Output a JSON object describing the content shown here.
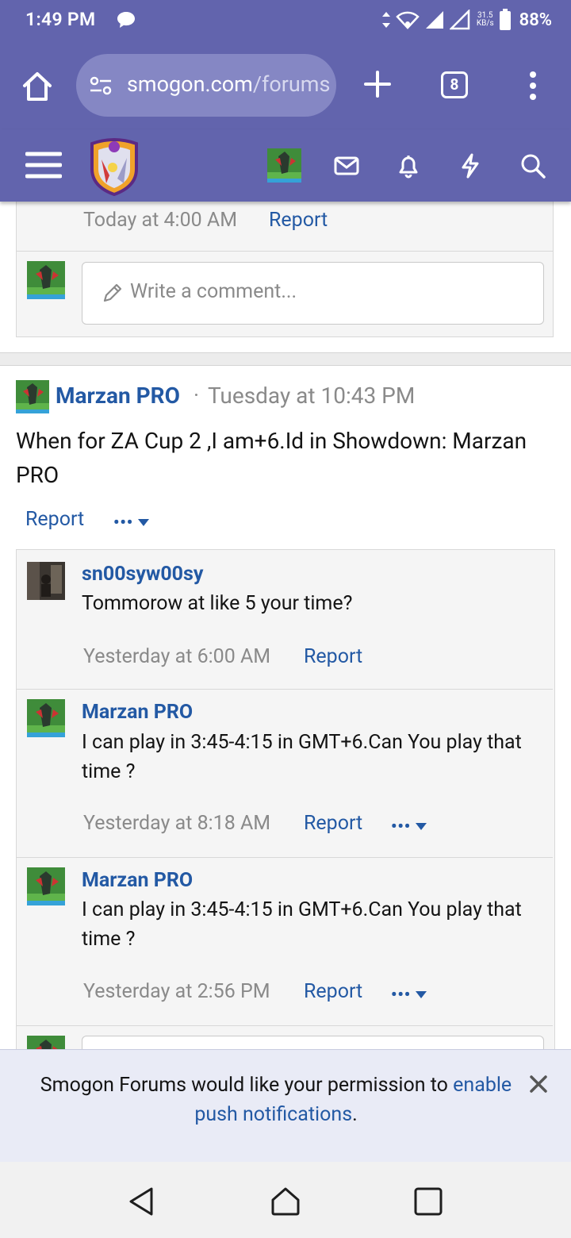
{
  "status": {
    "time": "1:49 PM",
    "speed_value": "31.5",
    "speed_unit": "KB/s",
    "battery": "88%"
  },
  "browser": {
    "url_main": "smogon.com",
    "url_rest": "/forums",
    "tab_count": "8"
  },
  "top_comment": {
    "time": "Today at 4:00 AM",
    "report": "Report",
    "placeholder": "Write a comment..."
  },
  "post": {
    "author": "Marzan PRO",
    "separator": "·",
    "time": "Tuesday at 10:43 PM",
    "body": "When for ZA Cup 2 ,I am+6.Id in Showdown: Marzan PRO",
    "report": "Report",
    "more": "•••"
  },
  "replies": [
    {
      "author": "sn00syw00sy",
      "text": "Tommorow at like 5 your time?",
      "time": "Yesterday at 6:00 AM",
      "report": "Report"
    },
    {
      "author": "Marzan PRO",
      "text": "I can play in 3:45-4:15 in GMT+6.Can You play that time ?",
      "time": "Yesterday at 8:18 AM",
      "report": "Report",
      "more": "•••"
    },
    {
      "author": "Marzan PRO",
      "text": "I can play in 3:45-4:15 in GMT+6.Can You play that time ?",
      "time": "Yesterday at 2:56 PM",
      "report": "Report",
      "more": "•••"
    }
  ],
  "push": {
    "text": "Smogon Forums would like your permission to ",
    "link": "enable push notifications",
    "end": "."
  },
  "icons": [
    "home-icon",
    "tune-icon",
    "plus-icon",
    "menu-dots-icon",
    "hamburger-icon",
    "mail-icon",
    "bell-icon",
    "bolt-icon",
    "search-icon",
    "pencil-icon",
    "close-icon",
    "back-icon",
    "home-nav-icon",
    "recents-icon"
  ]
}
